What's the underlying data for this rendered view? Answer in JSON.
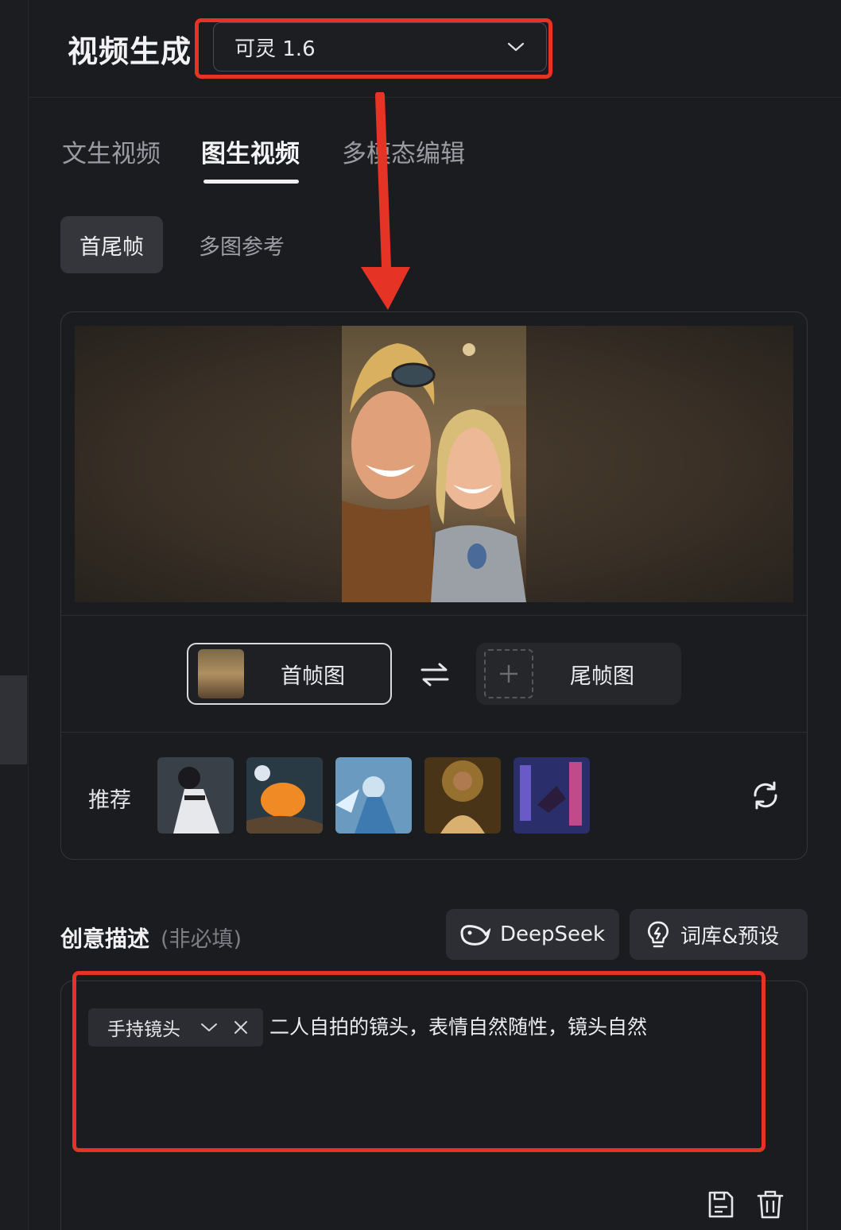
{
  "header": {
    "title": "视频生成",
    "model_value": "可灵 1.6"
  },
  "tabs": [
    {
      "label": "文生视频",
      "active": false
    },
    {
      "label": "图生视频",
      "active": true
    },
    {
      "label": "多模态编辑",
      "active": false
    }
  ],
  "subtabs": [
    {
      "label": "首尾帧",
      "active": true
    },
    {
      "label": "多图参考",
      "active": false
    }
  ],
  "frames": {
    "first_label": "首帧图",
    "last_label": "尾帧图"
  },
  "recommend": {
    "label": "推荐",
    "thumbnails": [
      "cat-warrior",
      "pumpkin-scene",
      "ice-fairy",
      "golden-musician",
      "cyber-city"
    ]
  },
  "description": {
    "title": "创意描述",
    "optional": "(非必填)",
    "deepseek_label": "DeepSeek",
    "library_label": "词库&预设",
    "chip_label": "手持镜头",
    "text": "二人自拍的镜头，表情自然随性，镜头自然"
  },
  "colors": {
    "annotation": "#e53425",
    "background": "#1a1c20"
  },
  "icons": [
    "chevron-down-icon",
    "swap-icon",
    "plus-icon",
    "refresh-icon",
    "deepseek-whale-icon",
    "lightbulb-icon",
    "close-icon",
    "save-icon",
    "trash-icon"
  ]
}
